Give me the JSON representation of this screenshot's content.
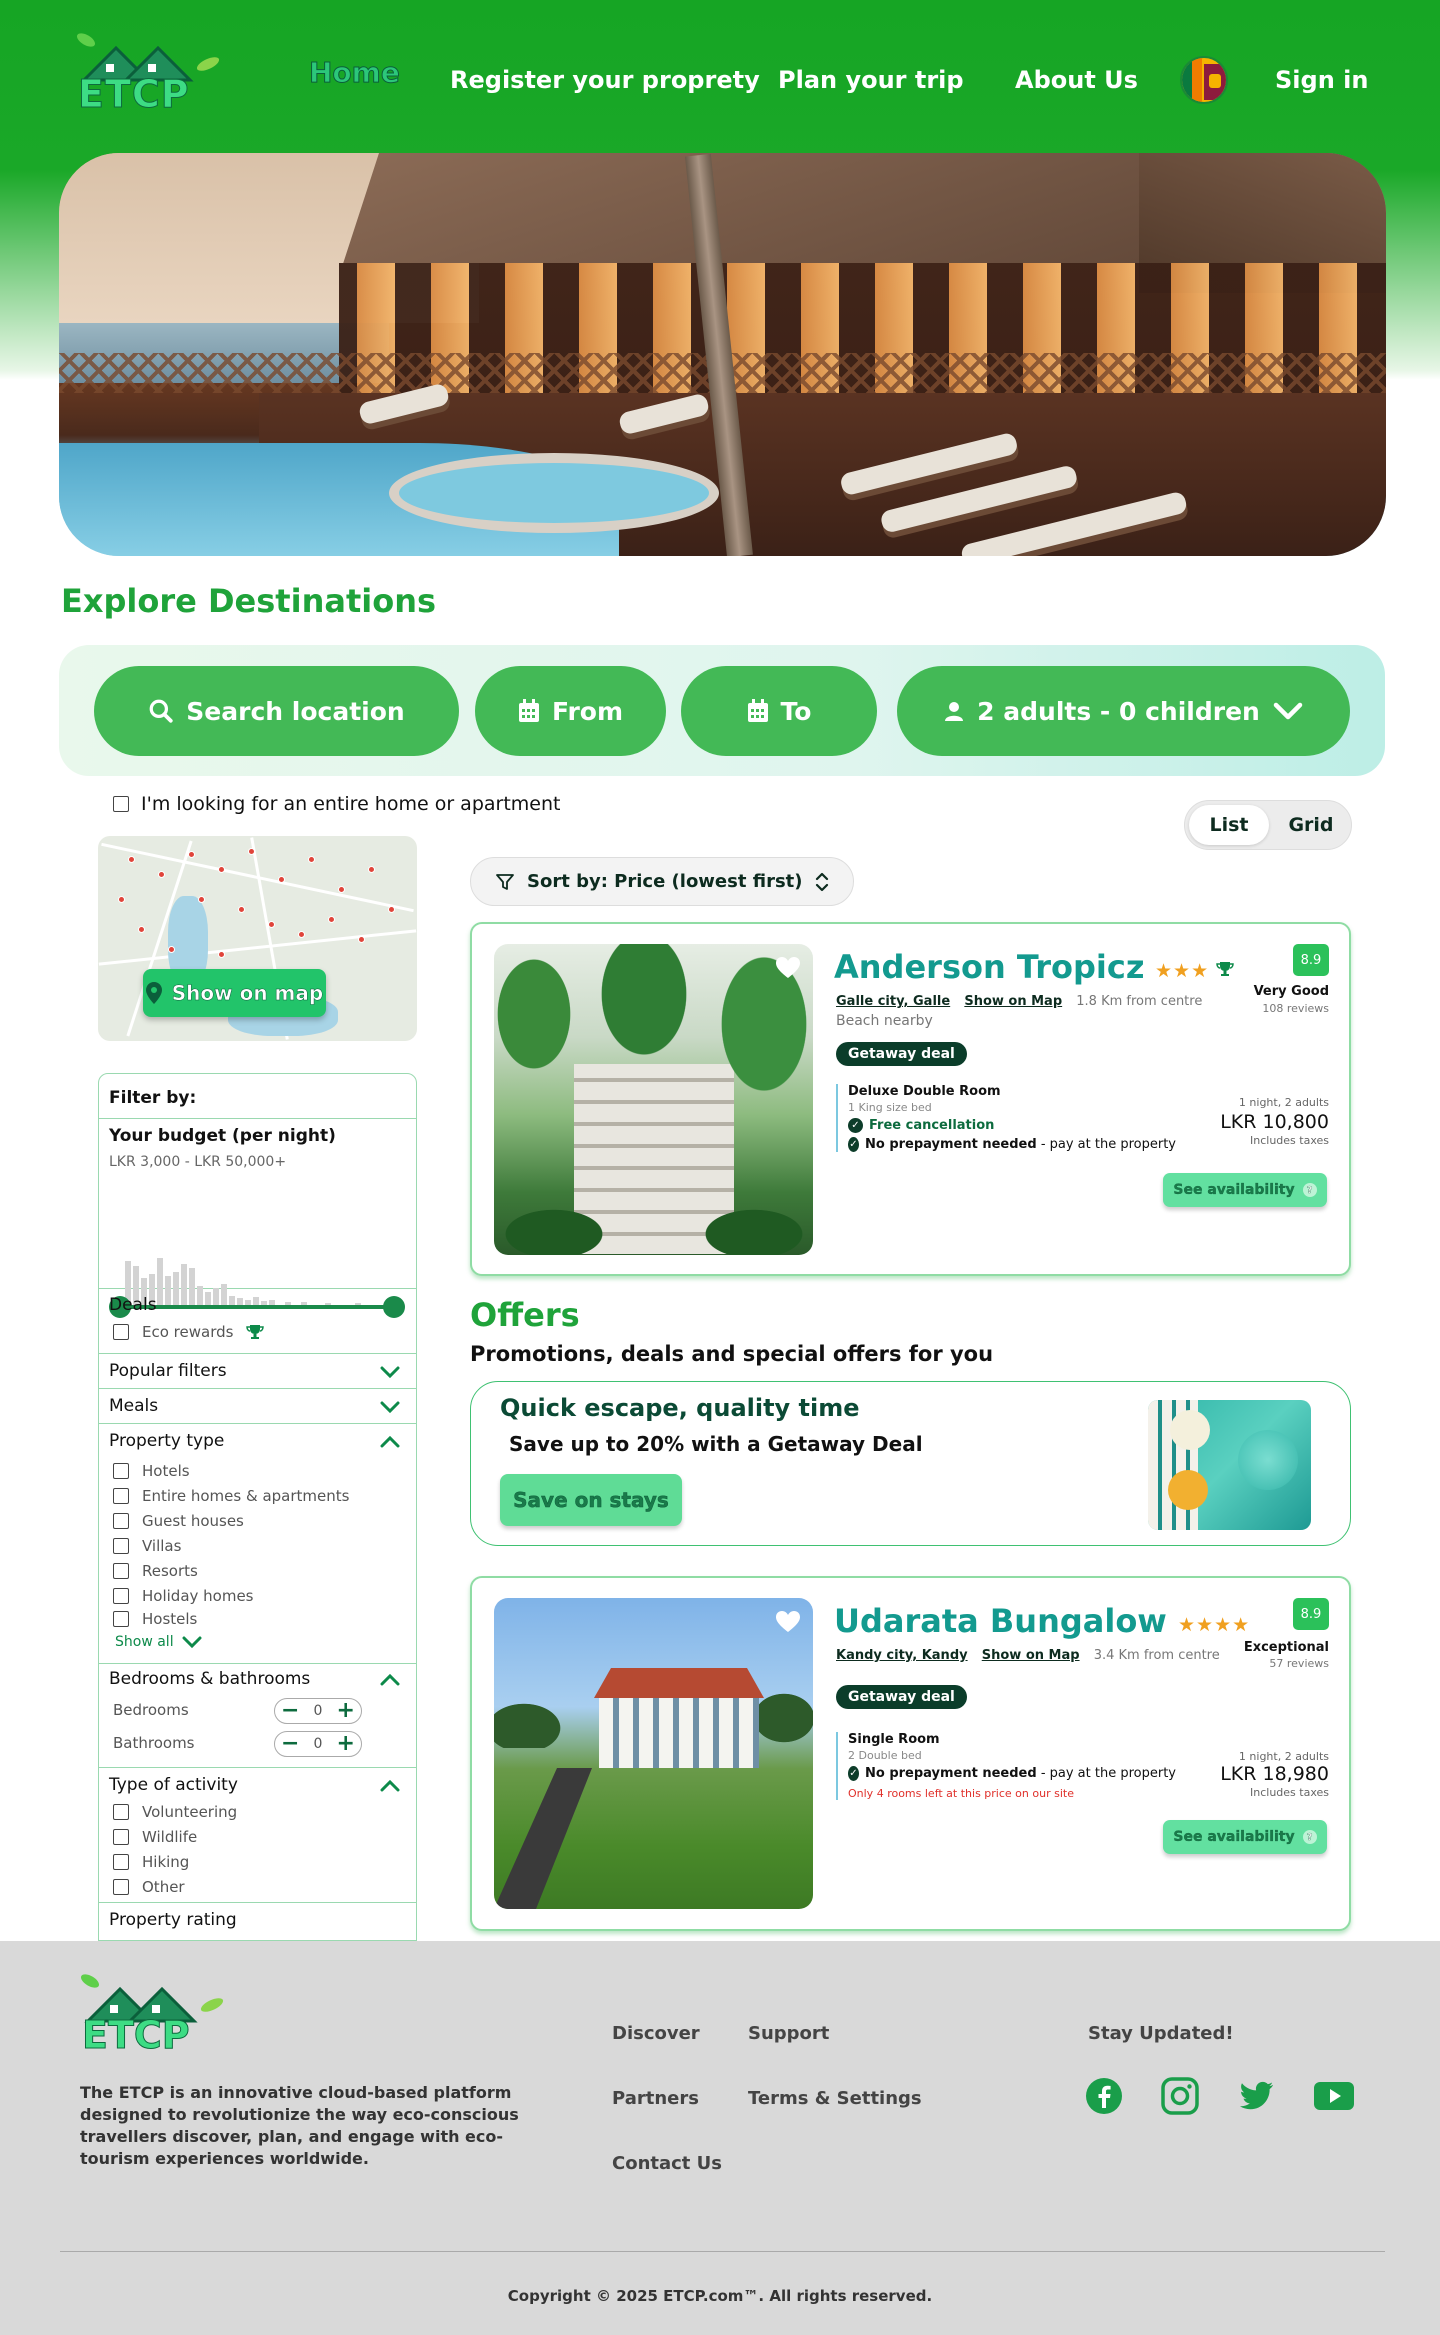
{
  "header": {
    "logo_text": "ETCP",
    "nav": {
      "home": "Home",
      "register": "Register your proprety",
      "plan": "Plan your trip",
      "about": "About Us",
      "signin": "Sign in"
    }
  },
  "explore": {
    "title": "Explore Destinations",
    "search_location": "Search location",
    "from": "From",
    "to": "To",
    "guests": "2 adults - 0 children",
    "entire_home": "I'm looking for an entire home or apartment"
  },
  "view": {
    "list": "List",
    "grid": "Grid",
    "selected": "List"
  },
  "map": {
    "show_on_map": "Show on map"
  },
  "filters": {
    "title": "Filter by:",
    "budget_title": "Your budget (per night)",
    "budget_range": "LKR 3,000 - LKR 50,000+",
    "deals_title": "Deals",
    "eco_rewards": "Eco rewards",
    "popular": "Popular filters",
    "meals": "Meals",
    "property_type": "Property type",
    "property_types": [
      "Hotels",
      "Entire homes & apartments",
      "Guest houses",
      "Villas",
      "Resorts",
      "Holiday homes",
      "Hostels"
    ],
    "show_all": "Show all",
    "bed_bath": "Bedrooms & bathrooms",
    "bedrooms": "Bedrooms",
    "bathrooms": "Bathrooms",
    "bedrooms_value": "0",
    "bathrooms_value": "0",
    "activity": "Type of activity",
    "activities": [
      "Volunteering",
      "Wildlife",
      "Hiking",
      "Other"
    ],
    "rating": "Property rating"
  },
  "sort": {
    "label": "Sort by: Price (lowest first)"
  },
  "listings": [
    {
      "name": "Anderson Tropicz",
      "stars": "★★★",
      "score": "8.9",
      "rating_label": "Very Good",
      "reviews": "108 reviews",
      "location": "Galle city, Galle",
      "show_on_map": "Show on Map",
      "distance": "1.8 Km from centre",
      "extra": "Beach nearby",
      "deal": "Getaway deal",
      "room": "Deluxe Double Room",
      "bed": "1 King size bed",
      "feature1": "Free cancellation",
      "feature2_bold": "No prepayment needed",
      "feature2_rest": " - pay at the property",
      "price_meta": "1 night, 2 adults",
      "price": "LKR 10,800",
      "taxes": "Includes taxes",
      "cta": "See availability"
    },
    {
      "name": "Udarata Bungalow",
      "stars": "★★★★",
      "score": "8.9",
      "rating_label": "Exceptional",
      "reviews": "57 reviews",
      "location": "Kandy city, Kandy",
      "show_on_map": "Show on Map",
      "distance": "3.4 Km from centre",
      "deal": "Getaway deal",
      "room": "Single Room",
      "bed": "2 Double bed",
      "feature2_bold": "No prepayment needed",
      "feature2_rest": " - pay at the property",
      "warning": "Only 4 rooms left at this price on our site",
      "price_meta": "1 night, 2 adults",
      "price": "LKR 18,980",
      "taxes": "Includes taxes",
      "cta": "See availability"
    }
  ],
  "offers": {
    "title": "Offers",
    "subtitle": "Promotions, deals and special offers for you",
    "card_title": "Quick escape, quality time",
    "card_sub": "Save up to 20% with a Getaway Deal",
    "card_cta": "Save on stays"
  },
  "footer": {
    "logo_text": "ETCP",
    "description": "The ETCP is an innovative cloud-based platform designed to revolutionize the way eco-conscious travellers discover, plan, and engage with eco-tourism experiences worldwide.",
    "links": {
      "discover": "Discover",
      "support": "Support",
      "partners": "Partners",
      "terms": "Terms & Settings",
      "contact": "Contact Us"
    },
    "stay_updated": "Stay Updated!",
    "copyright": "Copyright © 2025 ETCP.com™. All rights reserved."
  },
  "colors": {
    "brand_green": "#16a524",
    "accent_teal": "#139a8f",
    "button_green": "#43b956"
  }
}
